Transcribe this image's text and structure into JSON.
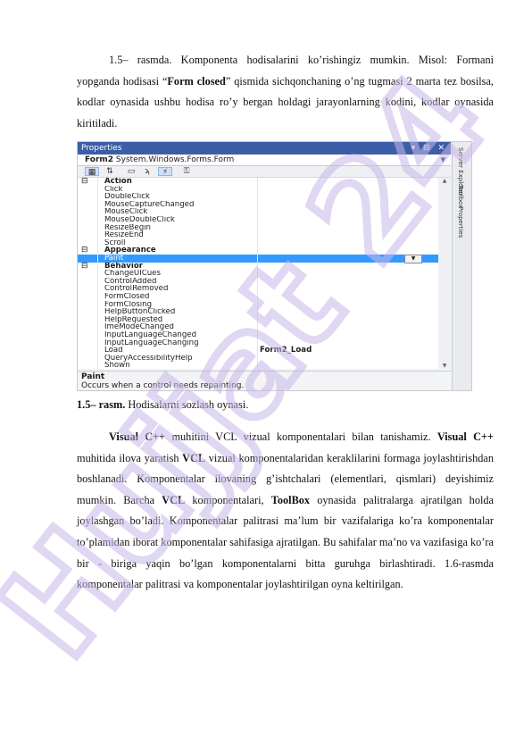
{
  "para1": {
    "line1": "1.5– rasmda. Komponenta hodisalarini ko’rishingiz mumkin. Misol:",
    "line2_a": "Formani yopganda hodisasi “",
    "line2_b": "Form closed",
    "line2_c": "” qismida sichqonchaning o’ng tugmasi",
    "line3": "2 marta tez bosilsa, kodlar oynasida ushbu hodisa ro’y bergan holdagi",
    "line4": "jarayonlarning kodini, kodlar oynasida kiritiladi."
  },
  "screenshot": {
    "title": "Properties",
    "title_buttons": "▾ ⊟ ✕",
    "object_bold": "Form2",
    "object_rest": " System.Windows.Forms.Form",
    "toolbar": [
      "▦",
      "⇅",
      "▭",
      "ϡ",
      "⚡",
      "⚿"
    ],
    "rows": [
      {
        "name": "Action",
        "cat": true,
        "tog": "⊟"
      },
      {
        "name": "Click"
      },
      {
        "name": "DoubleClick"
      },
      {
        "name": "MouseCaptureChanged"
      },
      {
        "name": "MouseClick"
      },
      {
        "name": "MouseDoubleClick"
      },
      {
        "name": "ResizeBegin"
      },
      {
        "name": "ResizeEnd"
      },
      {
        "name": "Scroll"
      },
      {
        "name": "Appearance",
        "cat": true,
        "tog": "⊟"
      },
      {
        "name": "Paint",
        "sel": true
      },
      {
        "name": "Behavior",
        "cat": true,
        "tog": "⊟"
      },
      {
        "name": "ChangeUICues"
      },
      {
        "name": "ControlAdded"
      },
      {
        "name": "ControlRemoved"
      },
      {
        "name": "FormClosed"
      },
      {
        "name": "FormClosing"
      },
      {
        "name": "HelpButtonClicked"
      },
      {
        "name": "HelpRequested"
      },
      {
        "name": "ImeModeChanged"
      },
      {
        "name": "InputLanguageChanged"
      },
      {
        "name": "InputLanguageChanging"
      },
      {
        "name": "Load",
        "value": "Form2_Load"
      },
      {
        "name": "QueryAccessibilityHelp"
      },
      {
        "name": "Shown"
      }
    ],
    "desc_title": "Paint",
    "desc_text": "Occurs when a control needs repainting.",
    "side_tabs": [
      "Server Explorer",
      "Toolbox",
      "Properties"
    ]
  },
  "caption": {
    "bold": "1.5– rasm.",
    "text": " Hodisalarni sozlash oynasi."
  },
  "para2": {
    "l1_a": "Visual C++",
    "l1_b": " muhitini VCL vizual komponentalari bilan tanishamiz. ",
    "l1_c": "Visual",
    "l2_a": "C++",
    "l2_b": " muhitida ilova yaratish ",
    "l2_c": "VCL",
    "l2_d": " vizual komponentalaridan keraklilarini formaga",
    "l3": "joylashtirishdan boshlanadi. Komponentalar ilovaning g’ishtchalari (elementlari,",
    "l4_a": "qismlari) deyishimiz mumkin. Barcha ",
    "l4_b": "VCL",
    "l4_c": " komponentalari, ",
    "l4_d": "ToolBox",
    "l4_e": " oynasida",
    "l5": "palitralarga ajratilgan holda joylashgan bo’ladi. Komponentalar palitrasi ma’lum",
    "l6": "bir vazifalariga ko’ra komponentalar to’plamidan iborat komponentalar sahifasiga",
    "l7": "ajratilgan. Bu sahifalar ma’no va vazifasiga ko’ra bir - biriga yaqin bo’lgan",
    "l8": "komponentalarni bitta guruhga birlashtiradi. 1.6-rasmda komponentalar palitrasi va",
    "l9": "komponentalar joylashtirilgan oyna keltirilgan."
  },
  "watermark": {
    "text": "Hujjat 24",
    "color": "#c8b7e8"
  }
}
